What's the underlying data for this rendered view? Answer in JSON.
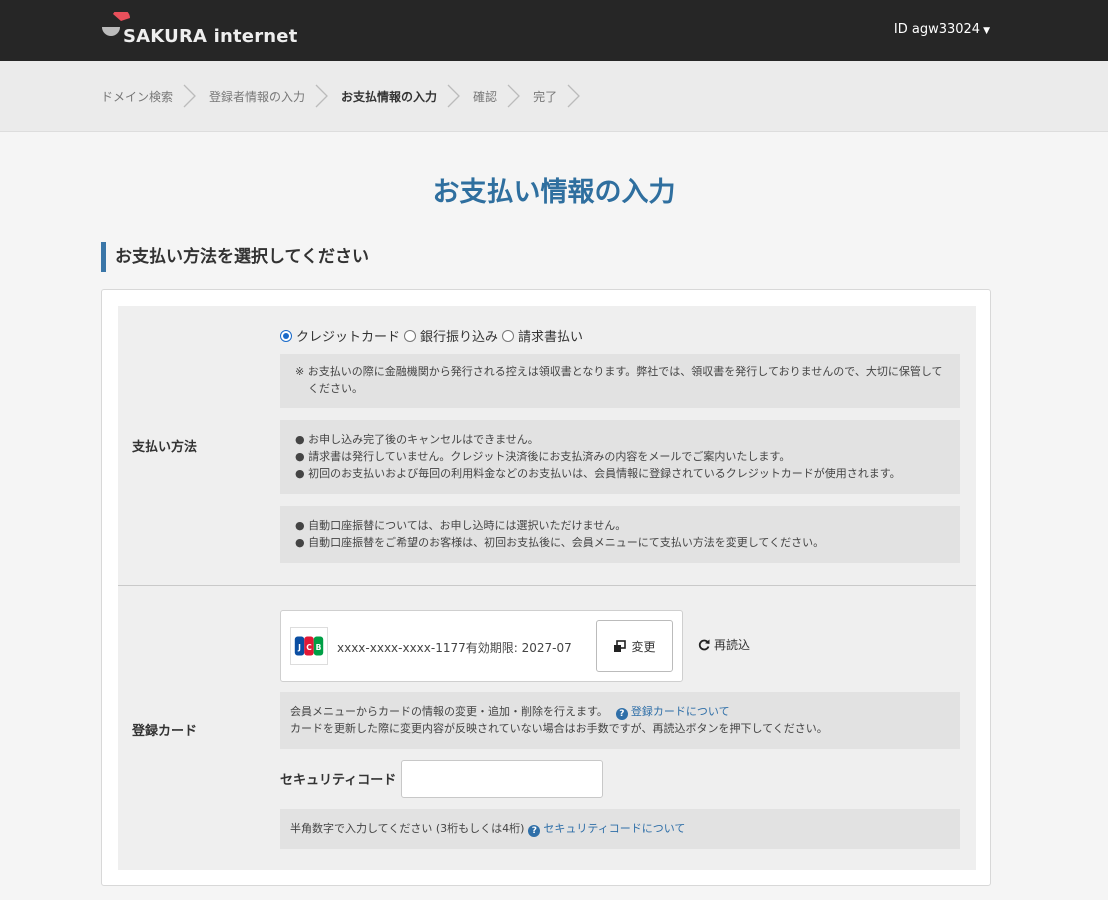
{
  "header": {
    "brand": "SAKURA internet",
    "user_label": "ID agw33024",
    "brand_color": "#e8505b"
  },
  "breadcrumb": [
    {
      "label": "ドメイン検索",
      "active": false
    },
    {
      "label": "登録者情報の入力",
      "active": false
    },
    {
      "label": "お支払情報の入力",
      "active": true
    },
    {
      "label": "確認",
      "active": false
    },
    {
      "label": "完了",
      "active": false
    }
  ],
  "page": {
    "title": "お支払い情報の入力",
    "section_heading": "お支払い方法を選択してください",
    "accent_color": "#2f6f9f"
  },
  "payment_method": {
    "label": "支払い方法",
    "options": [
      {
        "label": "クレジットカード",
        "selected": true
      },
      {
        "label": "銀行振り込み",
        "selected": false
      },
      {
        "label": "請求書払い",
        "selected": false
      }
    ],
    "note1": "※ お支払いの際に金融機関から発行される控えは領収書となります。弊社では、領収書を発行しておりませんので、大切に保管してください。",
    "note2": [
      "● お申し込み完了後のキャンセルはできません。",
      "● 請求書は発行していません。クレジット決済後にお支払済みの内容をメールでご案内いたします。",
      "● 初回のお支払いおよび毎回の利用料金などのお支払いは、会員情報に登録されているクレジットカードが使用されます。"
    ],
    "note3": [
      "● 自動口座振替については、お申し込時には選択いただけません。",
      "● 自動口座振替をご希望のお客様は、初回お支払後に、会員メニューにて支払い方法を変更してください。"
    ]
  },
  "registered_card": {
    "label": "登録カード",
    "card_brand_icon": "jcb-card-icon",
    "card_number": "xxxx-xxxx-xxxx-1177",
    "expiry": "有効期限: 2027-07",
    "change_button": "変更",
    "reload_button": "再読込",
    "info_line1": "会員メニューからカードの情報の変更・追加・削除を行えます。",
    "info_link": "登録カードについて",
    "info_line2": "カードを更新した際に変更内容が反映されていない場合はお手数ですが、再読込ボタンを押下してください。",
    "security_code_label": "セキュリティコード",
    "security_code_value": "",
    "security_hint": "半角数字で入力してください (3桁もしくは4桁)",
    "security_link": "セキュリティコードについて"
  }
}
